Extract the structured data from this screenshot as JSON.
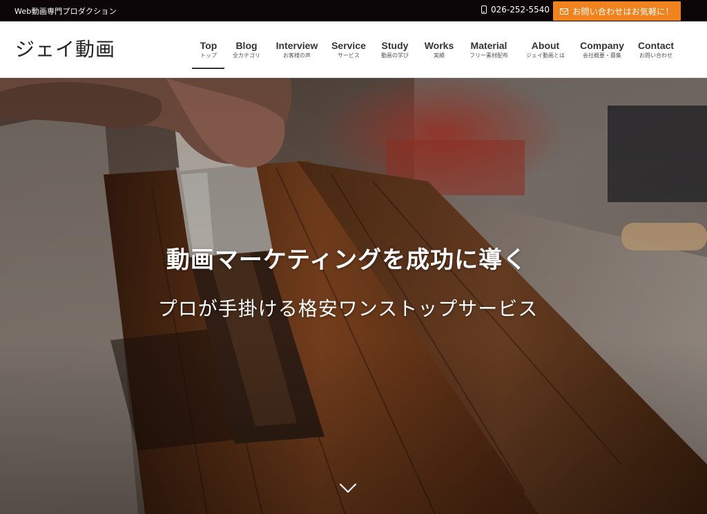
{
  "topbar": {
    "tagline": "Web動画専門プロダクション",
    "phone": "026-252-5540",
    "cta_label": "お問い合わせはお気軽に！"
  },
  "header": {
    "logo": "ジェイ動画"
  },
  "nav": {
    "items": [
      {
        "en": "Top",
        "ja": "トップ"
      },
      {
        "en": "Blog",
        "ja": "全カテゴリ"
      },
      {
        "en": "Interview",
        "ja": "お客様の声"
      },
      {
        "en": "Service",
        "ja": "サービス"
      },
      {
        "en": "Study",
        "ja": "動画の学び"
      },
      {
        "en": "Works",
        "ja": "実績"
      },
      {
        "en": "Material",
        "ja": "フリー素材配布"
      },
      {
        "en": "About",
        "ja": "ジェイ動画とは"
      },
      {
        "en": "Company",
        "ja": "会社概要・募集"
      },
      {
        "en": "Contact",
        "ja": "お問い合わせ"
      }
    ],
    "active": "Top"
  },
  "hero": {
    "title": "動画マーケティングを成功に導く",
    "subtitle": "プロが手掛ける格安ワンストップサービス"
  },
  "colors": {
    "accent": "#f0831e",
    "topbar_bg": "#0d0608",
    "header_bg": "#ffffff"
  },
  "icons": {
    "phone": "phone-icon",
    "mail": "mail-icon",
    "scroll": "chevron-down-icon"
  }
}
